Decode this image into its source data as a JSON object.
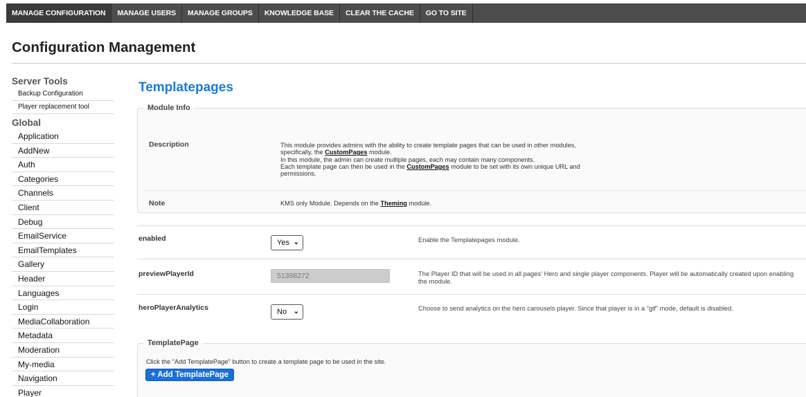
{
  "nav": {
    "items": [
      "MANAGE CONFIGURATION",
      "MANAGE USERS",
      "MANAGE GROUPS",
      "KNOWLEDGE BASE",
      "CLEAR THE CACHE",
      "GO TO SITE"
    ]
  },
  "page_title": "Configuration Management",
  "sidebar": {
    "server_tools_heading": "Server Tools",
    "server_tools": [
      "Backup Configuration",
      "Player replacement tool"
    ],
    "global_heading": "Global",
    "global_items": [
      "Application",
      "AddNew",
      "Auth",
      "Categories",
      "Channels",
      "Client",
      "Debug",
      "EmailService",
      "EmailTemplates",
      "Gallery",
      "Header",
      "Languages",
      "Login",
      "MediaCollaboration",
      "Metadata",
      "Moderation",
      "My-media",
      "Navigation",
      "Player"
    ]
  },
  "module": {
    "title": "Templatepages",
    "info_legend": "Module Info",
    "description_label": "Description",
    "description": {
      "l1": "This module provides admins with the ability to create template pages that can be used in other modules,",
      "l2_pre": "specifically, the ",
      "l2_link": "CustomPages",
      "l2_post": " module.",
      "l3": "In this module, the admin can create multiple pages, each may contain many components.",
      "l4_pre": "Each template page can then be used in the ",
      "l4_link": "CustomPages",
      "l4_post": " module to be set with its own unique URL and",
      "l5": "permissions."
    },
    "note_label": "Note",
    "note": {
      "pre": "KMS only Module. Depends on the ",
      "link": "Theming",
      "post": " module."
    }
  },
  "options": {
    "enabled": {
      "label": "enabled",
      "value": "Yes",
      "desc": "Enable the Templatepages module."
    },
    "previewPlayerId": {
      "label": "previewPlayerId",
      "value": "51398272",
      "desc": "The Player ID that will be used in all pages' Hero and single player components. Player will be automatically created upon enabling the module."
    },
    "heroPlayerAnalytics": {
      "label": "heroPlayerAnalytics",
      "value": "No",
      "desc": "Choose to send analytics on the hero carousels player. Since that player is in a “gif” mode, default is disabled."
    }
  },
  "template_page": {
    "legend": "TemplatePage",
    "help": "Click the \"Add TemplatePage\" button to create a template page to be used in the site.",
    "button": "+ Add TemplatePage"
  },
  "colors": {
    "nav_bg": "#4d4d4d",
    "accent": "#1a7ad9",
    "button": "#1a6fd8"
  },
  "icons": {
    "select_arrow": "chevron-down-icon"
  }
}
